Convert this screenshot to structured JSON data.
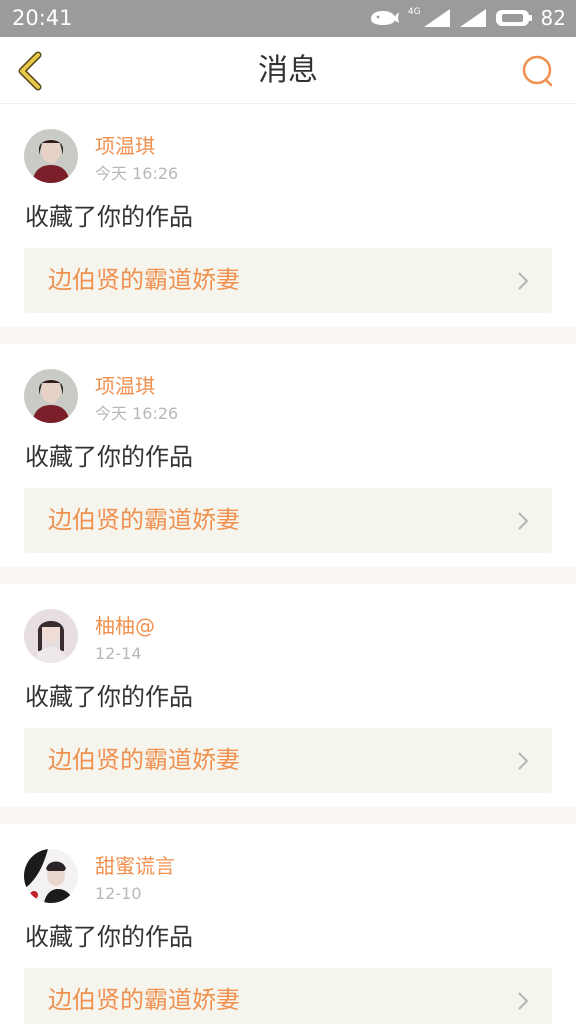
{
  "status_bar": {
    "time": "20:41",
    "network": "4G",
    "battery": "82",
    "icons": [
      "whale-icon",
      "signal-icon",
      "battery-icon"
    ]
  },
  "nav": {
    "title": "消息",
    "back_icon": "chevron-left-icon",
    "search_icon": "search-icon"
  },
  "colors": {
    "accent": "#f0914f",
    "back_icon": "#e6c84a",
    "status_bar": "#9b9b9b",
    "card_link_bg": "#f5f5ee",
    "gap": "#fbf6f4"
  },
  "messages": [
    {
      "user": "项温琪",
      "time": "今天 16:26",
      "action": "收藏了你的作品",
      "work": "边伯贤的霸道娇妻"
    },
    {
      "user": "项温琪",
      "time": "今天 16:26",
      "action": "收藏了你的作品",
      "work": "边伯贤的霸道娇妻"
    },
    {
      "user": "柚柚@",
      "time": "12-14",
      "action": "收藏了你的作品",
      "work": "边伯贤的霸道娇妻"
    },
    {
      "user": "甜蜜谎言",
      "time": "12-10",
      "action": "收藏了你的作品",
      "work": "边伯贤的霸道娇妻"
    }
  ]
}
